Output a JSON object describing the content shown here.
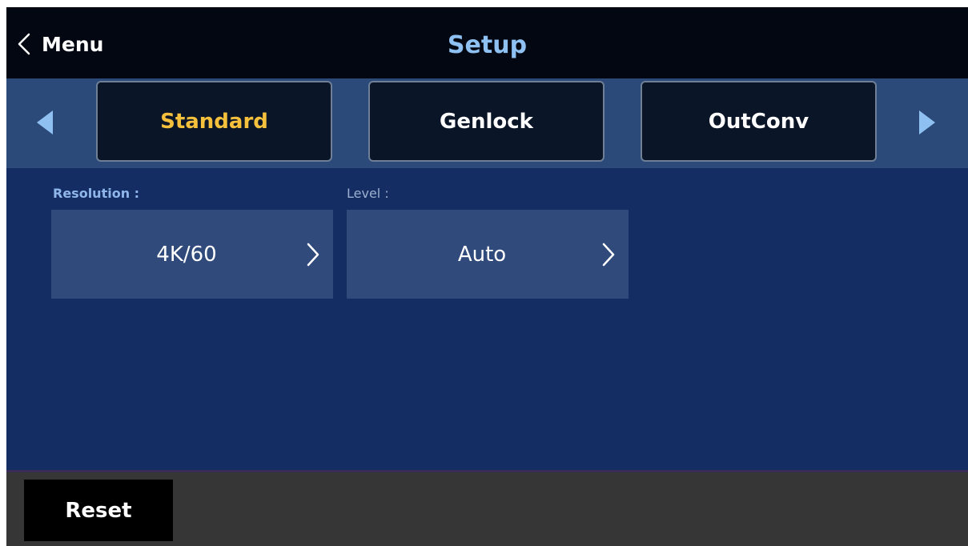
{
  "header": {
    "back_label": "Menu",
    "back_icon": "chevron-left-icon",
    "title": "Setup"
  },
  "tabs": [
    {
      "label": "Standard",
      "active": true
    },
    {
      "label": "Genlock",
      "active": false
    },
    {
      "label": "OutConv",
      "active": false
    }
  ],
  "tab_nav": {
    "prev_icon": "triangle-left-icon",
    "next_icon": "triangle-right-icon"
  },
  "fields": {
    "resolution": {
      "label": "Resolution :",
      "value": "4K/60"
    },
    "level": {
      "label": "Level :",
      "value": "Auto"
    }
  },
  "footer": {
    "reset_label": "Reset"
  },
  "colors": {
    "title": "#8fc0f2",
    "active_tab_text": "#f5c13c",
    "background": "#142d62",
    "tab_bar": "#2b4a7a",
    "select_box": "#304b7b",
    "arrow": "#8fc0f2"
  }
}
